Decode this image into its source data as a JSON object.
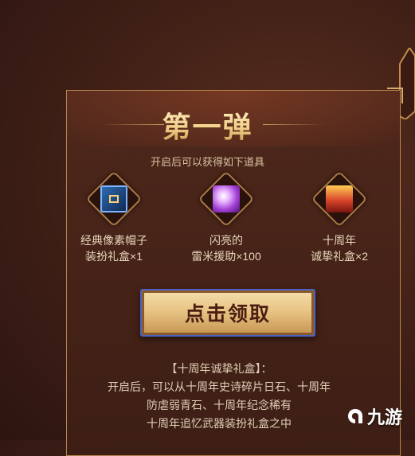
{
  "event": {
    "title": "第一弹",
    "subtitle": "开启后可以获得如下道具"
  },
  "items": [
    {
      "name": "经典像素帽子\n装扮礼盒×1",
      "icon": "treasure-box-icon"
    },
    {
      "name": "闪亮的\n雷米援助×100",
      "icon": "shining-crystal-icon"
    },
    {
      "name": "十周年\n诚挚礼盒×2",
      "icon": "gift-box-icon"
    }
  ],
  "claim_button_label": "点击领取",
  "description": {
    "heading": "【十周年诚挚礼盒】：",
    "lines": [
      "开启后，可以从十周年史诗碎片日石、十周年",
      "防虐弱青石、十周年纪念稀有",
      "十周年追忆武器装扮礼盒之中"
    ]
  },
  "watermark": {
    "text": "九游"
  },
  "colors": {
    "accent_gold": "#f2d28c",
    "panel_border": "#b8864d",
    "button_border": "#4d63c2"
  }
}
